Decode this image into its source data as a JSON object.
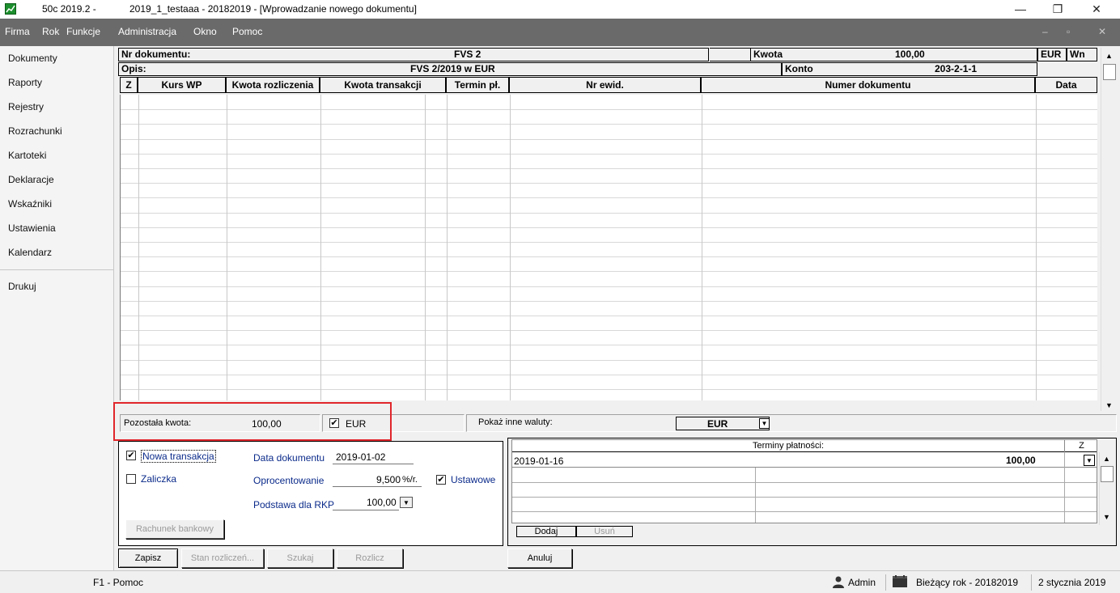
{
  "window": {
    "app_title": "50c 2019.2 -",
    "doc_title": "2019_1_testaaa - 20182019 - [Wprowadzanie nowego dokumentu]",
    "minimize": "—",
    "restore": "❐",
    "close": "✕"
  },
  "menu": {
    "items": [
      "Firma",
      "Rok",
      "Funkcje",
      "Administracja",
      "Okno",
      "Pomoc"
    ],
    "mdi_minimize": "–",
    "mdi_restore": "▫",
    "mdi_close": "✕"
  },
  "sidebar": {
    "items": [
      "Dokumenty",
      "Raporty",
      "Rejestry",
      "Rozrachunki",
      "Kartoteki",
      "Deklaracje",
      "Wskaźniki",
      "Ustawienia",
      "Kalendarz",
      "Drukuj"
    ]
  },
  "header": {
    "nr_label": "Nr dokumentu:",
    "nr_value": "FVS 2",
    "kwota_label": "Kwota",
    "kwota_value": "100,00",
    "currency": "EUR",
    "side": "Wn",
    "opis_label": "Opis:",
    "opis_value": "FVS 2/2019 w EUR",
    "konto_label": "Konto",
    "konto_value": "203-2-1-1"
  },
  "table": {
    "columns": [
      "Z",
      "Kurs WP",
      "Kwota rozliczenia",
      "Kwota transakcji",
      "Termin pł.",
      "Nr ewid.",
      "Numer dokumentu",
      "Data"
    ]
  },
  "remain": {
    "label": "Pozostała kwota:",
    "value": "100,00",
    "eur_checkbox_label": "EUR",
    "eur_checked": "✔",
    "show_other_label": "Pokaż inne waluty:",
    "currency_select": "EUR"
  },
  "form": {
    "nowa_transakcja_label": "Nowa transakcja",
    "nowa_transakcja_mark": "✔",
    "zaliczka_label": "Zaliczka",
    "data_dokumentu_label": "Data dokumentu",
    "data_dokumentu_value": "2019-01-02",
    "oprocentowanie_label": "Oprocentowanie",
    "oprocentowanie_value": "9,500",
    "oprocentowanie_unit": "%/r.",
    "ustawowe_label": "Ustawowe",
    "ustawowe_mark": "✔",
    "podstawa_label": "Podstawa dla RKP",
    "podstawa_value": "100,00",
    "rachunek_button": "Rachunek bankowy"
  },
  "terms": {
    "header": "Terminy płatności:",
    "z_header": "Z",
    "rows": [
      {
        "date": "2019-01-16",
        "amount": "100,00"
      }
    ],
    "add_button": "Dodaj",
    "remove_button": "Usuń"
  },
  "buttons": {
    "zapisz": "Zapisz",
    "stan": "Stan rozliczeń...",
    "szukaj": "Szukaj",
    "rozlicz": "Rozlicz",
    "anuluj": "Anuluj"
  },
  "status": {
    "help": "F1 - Pomoc",
    "user": "Admin",
    "year": "Bieżący rok - 20182019",
    "date": "2 stycznia 2019"
  },
  "colors": {
    "menubar": "#6a6a6a",
    "highlight": "#e0262b",
    "label_blue": "#0a2a8a"
  }
}
